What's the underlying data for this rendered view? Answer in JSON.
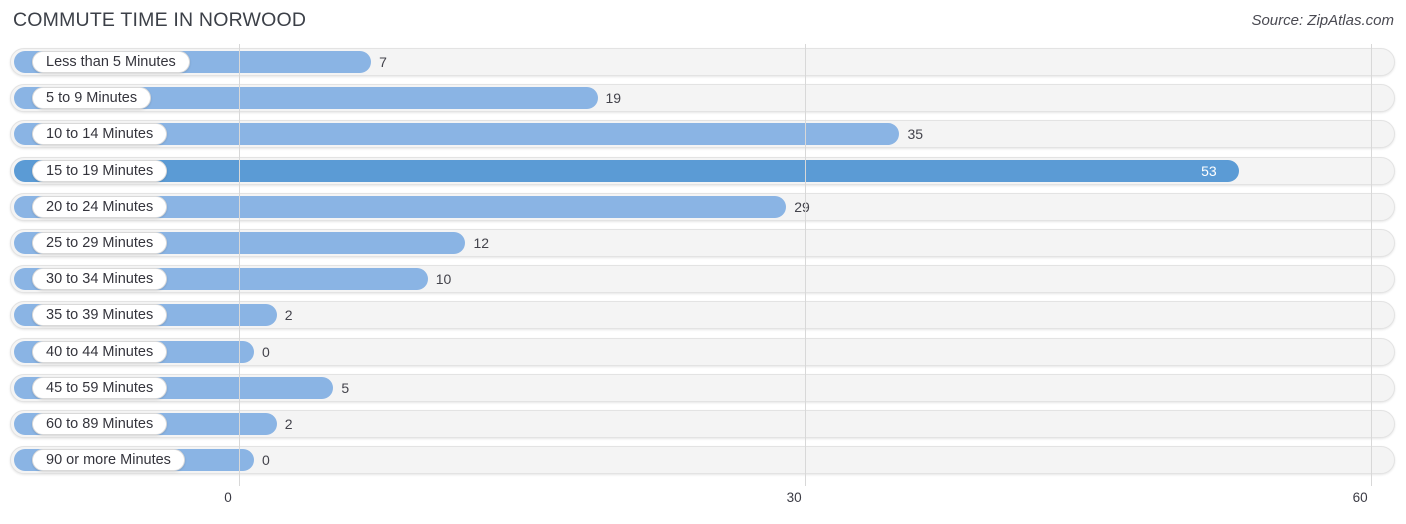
{
  "header": {
    "title": "COMMUTE TIME IN NORWOOD",
    "source": "Source: ZipAtlas.com"
  },
  "chart_data": {
    "type": "bar",
    "orientation": "horizontal",
    "title": "COMMUTE TIME IN NORWOOD",
    "subtitle": "Source: ZipAtlas.com",
    "xlabel": "",
    "ylabel": "",
    "xlim": [
      0,
      60
    ],
    "grid": true,
    "legend": null,
    "xticks": [
      "0",
      "30",
      "60"
    ],
    "xtick_values": [
      0,
      30,
      60
    ],
    "categories": [
      "Less than 5 Minutes",
      "5 to 9 Minutes",
      "10 to 14 Minutes",
      "15 to 19 Minutes",
      "20 to 24 Minutes",
      "25 to 29 Minutes",
      "30 to 34 Minutes",
      "35 to 39 Minutes",
      "40 to 44 Minutes",
      "45 to 59 Minutes",
      "60 to 89 Minutes",
      "90 or more Minutes"
    ],
    "values": [
      7,
      19,
      35,
      53,
      29,
      12,
      10,
      2,
      0,
      5,
      2,
      0
    ],
    "value_labels": [
      "7",
      "19",
      "35",
      "53",
      "29",
      "12",
      "10",
      "2",
      "0",
      "5",
      "2",
      "0"
    ],
    "highlight_index": 3,
    "colors": {
      "bar": "#8ab4e4",
      "bar_highlight": "#5b9bd5",
      "track": "#f4f4f4",
      "track_border": "#e3e3e3",
      "grid": "#d8d8d8",
      "text": "#3b3b44",
      "value_inside": "#ffffff"
    }
  },
  "rows": [
    {
      "label": "Less than 5 Minutes",
      "value": 7,
      "value_label": "7",
      "highlight": false
    },
    {
      "label": "5 to 9 Minutes",
      "value": 19,
      "value_label": "19",
      "highlight": false
    },
    {
      "label": "10 to 14 Minutes",
      "value": 35,
      "value_label": "35",
      "highlight": false
    },
    {
      "label": "15 to 19 Minutes",
      "value": 53,
      "value_label": "53",
      "highlight": true
    },
    {
      "label": "20 to 24 Minutes",
      "value": 29,
      "value_label": "29",
      "highlight": false
    },
    {
      "label": "25 to 29 Minutes",
      "value": 12,
      "value_label": "12",
      "highlight": false
    },
    {
      "label": "30 to 34 Minutes",
      "value": 10,
      "value_label": "10",
      "highlight": false
    },
    {
      "label": "35 to 39 Minutes",
      "value": 2,
      "value_label": "2",
      "highlight": false
    },
    {
      "label": "40 to 44 Minutes",
      "value": 0,
      "value_label": "0",
      "highlight": false
    },
    {
      "label": "45 to 59 Minutes",
      "value": 5,
      "value_label": "5",
      "highlight": false
    },
    {
      "label": "60 to 89 Minutes",
      "value": 2,
      "value_label": "2",
      "highlight": false
    },
    {
      "label": "90 or more Minutes",
      "value": 0,
      "value_label": "0",
      "highlight": false
    }
  ],
  "axis": {
    "ticks": [
      {
        "label": "0",
        "value": 0
      },
      {
        "label": "30",
        "value": 30
      },
      {
        "label": "60",
        "value": 60
      }
    ]
  }
}
